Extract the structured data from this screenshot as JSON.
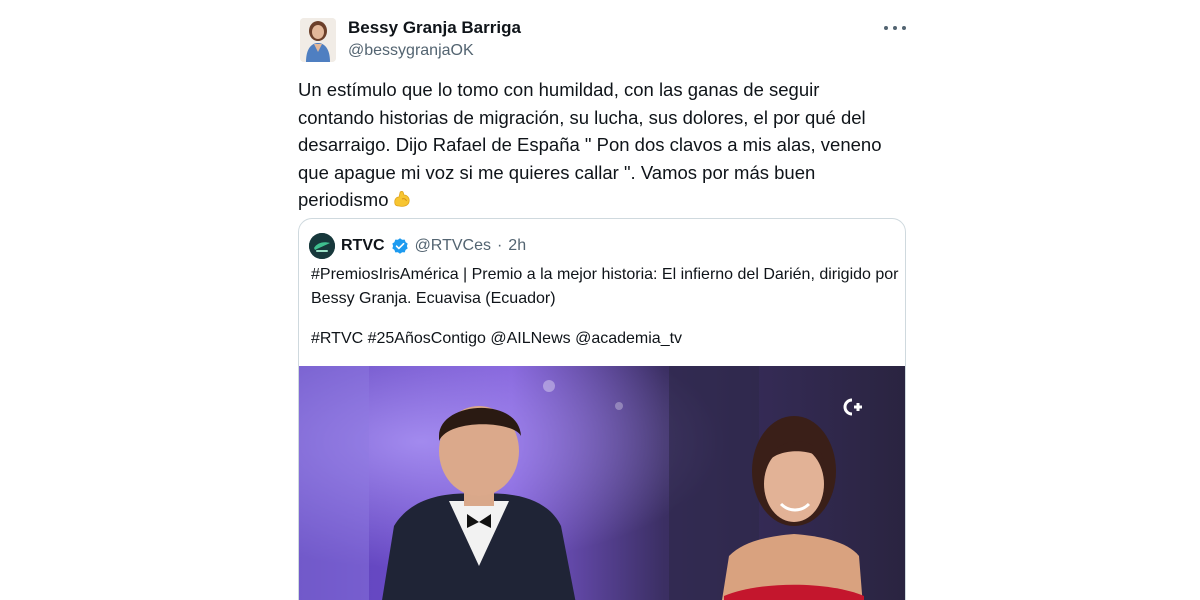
{
  "tweet": {
    "author_name": "Bessy Granja Barriga",
    "author_handle": "@bessygranjaOK",
    "text": "Un estímulo que lo tomo con humildad, con las ganas de seguir contando historias de migración, su lucha, sus dolores, el por qué del desarraigo. Dijo Rafael de España \" Pon dos clavos a mis alas, veneno que apague mi voz si me quieres callar \". Vamos por más buen periodismo",
    "emoji_icon": "flexed-biceps-icon",
    "more_icon": "more-horizontal-icon"
  },
  "quote": {
    "author_name": "RTVC",
    "verified_icon": "verified-badge-icon",
    "author_handle": "@RTVCes",
    "separator": "·",
    "time": "2h",
    "text": "#PremiosIrisAmérica | Premio a la mejor historia: El infierno del Darién, dirigido por Bessy Granja. Ecuavisa (Ecuador)",
    "tags": "#RTVC #25AñosContigo @AILNews @academia_tv",
    "media_icon": "tv-watermark-icon"
  },
  "colors": {
    "text_primary": "#0f1419",
    "text_secondary": "#536471",
    "verified_blue": "#1d9bf0",
    "border": "#cfd9de"
  }
}
